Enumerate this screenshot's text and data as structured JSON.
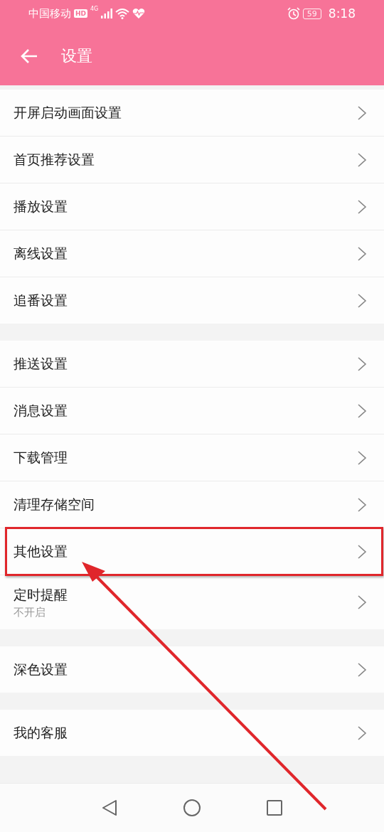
{
  "status_bar": {
    "carrier": "中国移动",
    "hd": "HD",
    "network": "4G",
    "battery": "59",
    "time": "8:18"
  },
  "header": {
    "title": "设置"
  },
  "groups": [
    {
      "items": [
        {
          "label": "开屏启动画面设置",
          "highlighted": false
        },
        {
          "label": "首页推荐设置",
          "highlighted": false
        },
        {
          "label": "播放设置",
          "highlighted": false
        },
        {
          "label": "离线设置",
          "highlighted": false
        },
        {
          "label": "追番设置",
          "highlighted": false
        }
      ]
    },
    {
      "items": [
        {
          "label": "推送设置",
          "highlighted": false
        },
        {
          "label": "消息设置",
          "highlighted": false
        },
        {
          "label": "下载管理",
          "highlighted": false
        },
        {
          "label": "清理存储空间",
          "highlighted": false
        },
        {
          "label": "其他设置",
          "highlighted": true
        },
        {
          "label": "定时提醒",
          "subtitle": "不开启",
          "highlighted": false
        }
      ]
    },
    {
      "items": [
        {
          "label": "深色设置",
          "highlighted": false
        }
      ]
    },
    {
      "items": [
        {
          "label": "我的客服",
          "highlighted": false
        }
      ]
    }
  ]
}
